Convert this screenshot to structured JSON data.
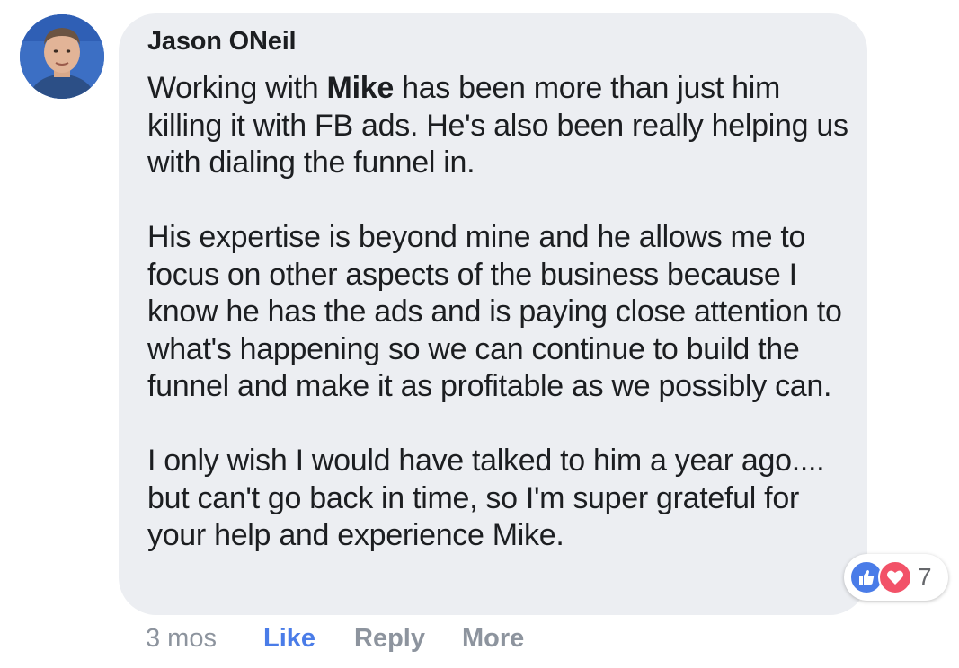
{
  "comment": {
    "author": "Jason ONeil",
    "paragraph1_before": "Working with ",
    "mention": "Mike",
    "paragraph1_after": " has been more than just him killing it with FB ads. He's also been really helping us with dialing the funnel in.",
    "paragraph2": "His expertise is beyond mine and he allows me to focus on other aspects of the business because I know he has the ads and is paying close attention to what's happening so we can continue to build the funnel and make it as profitable as we possibly can.",
    "paragraph3": "I only wish I would have talked to him a year ago.... but can't go back in time, so I'm super grateful for your help and experience Mike."
  },
  "reactions": {
    "count": "7",
    "icons": [
      "like-icon",
      "love-icon"
    ],
    "like_color": "#4a7ce8",
    "love_color": "#f25268"
  },
  "actions": {
    "timestamp": "3 mos",
    "like_label": "Like",
    "reply_label": "Reply",
    "more_label": "More"
  },
  "colors": {
    "bubble": "#eceef2",
    "text": "#1c1e21",
    "muted": "#8d949e",
    "accent": "#4a7ce8"
  }
}
